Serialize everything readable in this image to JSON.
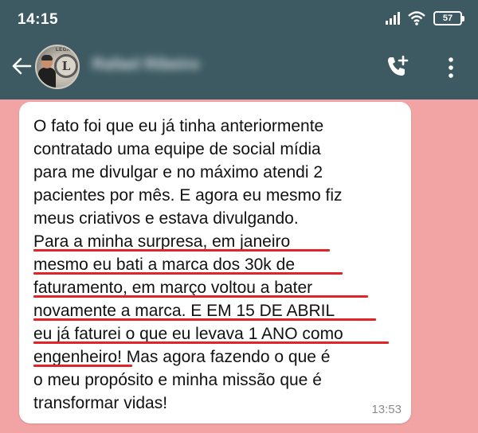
{
  "status_bar": {
    "time": "14:15",
    "battery": "57",
    "signal_icon": "signal-bars-icon",
    "wifi_icon": "wifi-icon"
  },
  "header": {
    "contact_name": "Rafael Ribeiro",
    "avatar_logo_text": "LEGACY",
    "avatar_logo_letter": "L",
    "background_color": "#3d5a62"
  },
  "chat": {
    "background_color": "#f2a3a3",
    "message": {
      "lines": [
        "O fato foi que eu já tinha anteriormente",
        "contratado uma equipe de social mídia",
        "para me divulgar e no máximo atendi 2",
        "pacientes por mês. E agora eu mesmo fiz",
        "meus criativos e estava divulgando.",
        "Para a minha surpresa, em janeiro",
        "mesmo eu bati a marca dos 30k de",
        "faturamento, em março voltou a bater",
        "novamente a marca. E EM 15 DE ABRIL",
        "eu já faturei o que eu levava 1 ANO como",
        "engenheiro! Mas agora fazendo o que é",
        "o meu propósito e minha missão que é",
        "transformar vidas!"
      ],
      "time": "13:53",
      "highlight_color": "#e0242a"
    }
  }
}
